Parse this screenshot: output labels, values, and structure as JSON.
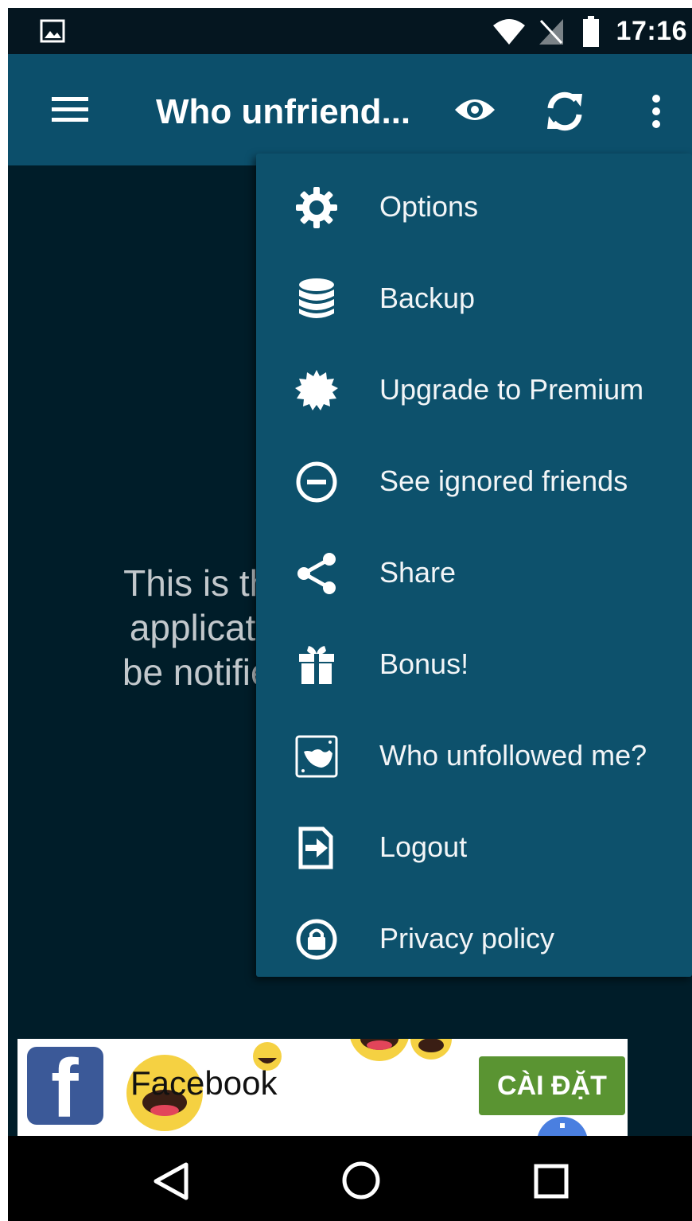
{
  "status_bar": {
    "time": "17:16",
    "icons": [
      "image-notification-icon",
      "wifi-icon",
      "no-signal-icon",
      "battery-icon"
    ]
  },
  "app_bar": {
    "title": "Who unfriend...",
    "icons": [
      "hamburger-menu-icon",
      "eye-icon",
      "refresh-icon",
      "overflow-menu-icon"
    ]
  },
  "main": {
    "message_lines": [
      "This is the",
      "applicatio",
      "be notified"
    ]
  },
  "menu": {
    "items": [
      {
        "label": "Options",
        "icon": "gear-icon"
      },
      {
        "label": "Backup",
        "icon": "database-icon"
      },
      {
        "label": "Upgrade to Premium",
        "icon": "badge-icon"
      },
      {
        "label": "See ignored friends",
        "icon": "minus-circle-icon"
      },
      {
        "label": "Share",
        "icon": "share-icon"
      },
      {
        "label": "Bonus!",
        "icon": "gift-icon"
      },
      {
        "label": "Who unfollowed me?",
        "icon": "bird-icon"
      },
      {
        "label": "Logout",
        "icon": "logout-icon"
      },
      {
        "label": "Privacy policy",
        "icon": "lock-circle-icon"
      }
    ]
  },
  "ad": {
    "logo_letter": "f",
    "brand": "Facebook",
    "cta": "CÀI ĐẶT"
  },
  "nav_bar": {
    "icons": [
      "back-icon",
      "home-icon",
      "recents-icon"
    ]
  },
  "colors": {
    "app_bar": "#0c4f6b",
    "menu": "#0d516c",
    "background": "#001d29",
    "cta": "#5a9432"
  }
}
